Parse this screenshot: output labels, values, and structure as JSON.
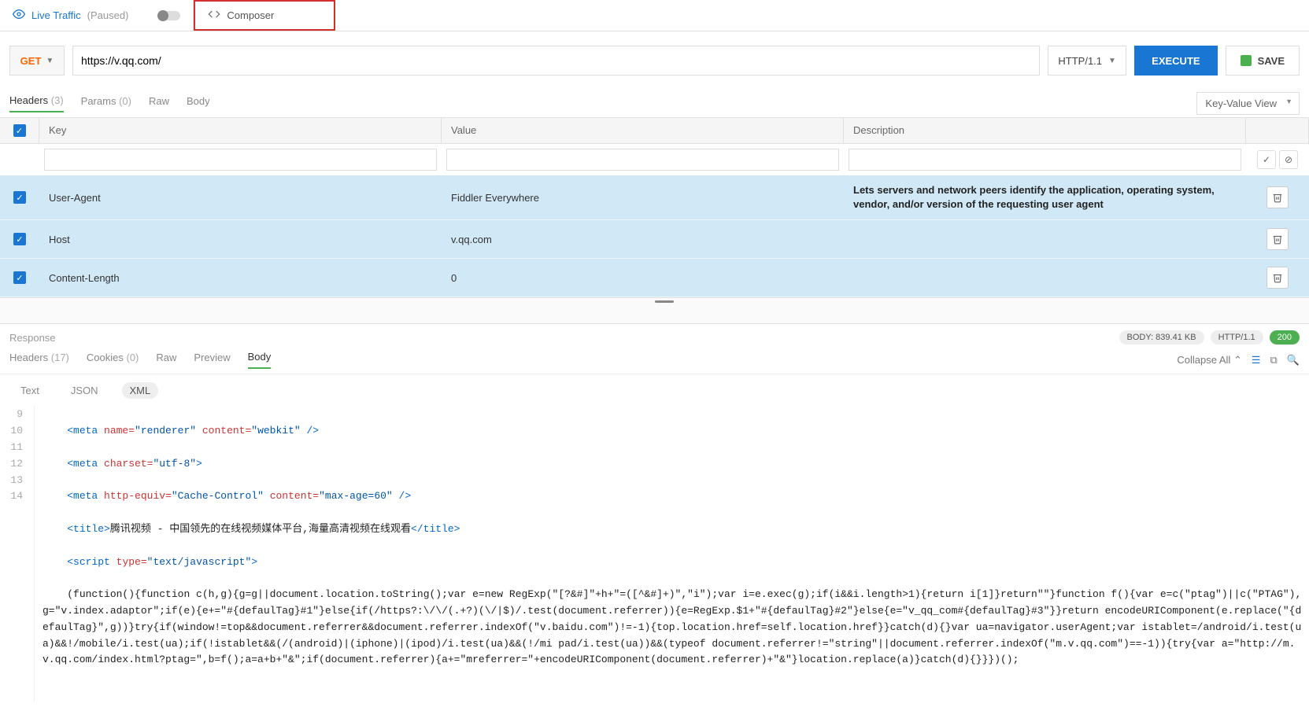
{
  "top": {
    "live_traffic": "Live Traffic",
    "paused": "(Paused)",
    "composer": "Composer"
  },
  "request": {
    "method": "GET",
    "url": "https://v.qq.com/",
    "http_version": "HTTP/1.1",
    "execute": "EXECUTE",
    "save": "SAVE"
  },
  "req_tabs": {
    "headers": "Headers",
    "headers_count": "(3)",
    "params": "Params",
    "params_count": "(0)",
    "raw": "Raw",
    "body": "Body",
    "view_mode": "Key-Value View"
  },
  "header_cols": {
    "key": "Key",
    "value": "Value",
    "description": "Description"
  },
  "headers": [
    {
      "key": "User-Agent",
      "value": "Fiddler Everywhere",
      "desc": "Lets servers and network peers identify the application, operating system, vendor, and/or version of the requesting user agent"
    },
    {
      "key": "Host",
      "value": "v.qq.com",
      "desc": ""
    },
    {
      "key": "Content-Length",
      "value": "0",
      "desc": ""
    }
  ],
  "response": {
    "title": "Response",
    "body_size": "BODY: 839.41 KB",
    "proto": "HTTP/1.1",
    "status": "200",
    "tabs": {
      "headers": "Headers",
      "headers_count": "(17)",
      "cookies": "Cookies",
      "cookies_count": "(0)",
      "raw": "Raw",
      "preview": "Preview",
      "body": "Body"
    },
    "collapse_all": "Collapse All",
    "body_tabs": {
      "text": "Text",
      "json": "JSON",
      "xml": "XML"
    }
  },
  "code": {
    "lines": [
      "9",
      "10",
      "11",
      "12",
      "13",
      "14"
    ],
    "l9_a": "<meta ",
    "l9_b": "name=",
    "l9_c": "\"renderer\"",
    "l9_d": " content=",
    "l9_e": "\"webkit\"",
    "l9_f": " />",
    "l10_a": "<meta ",
    "l10_b": "charset=",
    "l10_c": "\"utf-8\"",
    "l10_d": ">",
    "l11_a": "<meta ",
    "l11_b": "http-equiv=",
    "l11_c": "\"Cache-Control\"",
    "l11_d": " content=",
    "l11_e": "\"max-age=60\"",
    "l11_f": " />",
    "l12_a": "<title>",
    "l12_b": "腾讯视频 - 中国领先的在线视频媒体平台,海量高清视频在线观看",
    "l12_c": "</title>",
    "l13_a": "<script ",
    "l13_b": "type=",
    "l13_c": "\"text/javascript\"",
    "l13_d": ">",
    "l14": "(function(){function c(h,g){g=g||document.location.toString();var e=new RegExp(\"[?&#]\"+h+\"=([^&#]+)\",\"i\");var i=e.exec(g);if(i&&i.length>1){return i[1]}return\"\"}function f(){var e=c(\"ptag\")||c(\"PTAG\"),g=\"v.index.adaptor\";if(e){e+=\"#{defaulTag}#1\"}else{if(/https?:\\/\\/(.+?)(\\/|$)/.test(document.referrer)){e=RegExp.$1+\"#{defaulTag}#2\"}else{e=\"v_qq_com#{defaulTag}#3\"}}return encodeURIComponent(e.replace(\"{defaulTag}\",g))}try{if(window!=top&&document.referrer&&document.referrer.indexOf(\"v.baidu.com\")!=-1){top.location.href=self.location.href}}catch(d){}var ua=navigator.userAgent;var istablet=/android/i.test(ua)&&!/mobile/i.test(ua);if(!istablet&&(/(android)|(iphone)|(ipod)/i.test(ua)&&(!/mi pad/i.test(ua))&&(typeof document.referrer!=\"string\"||document.referrer.indexOf(\"m.v.qq.com\")==-1)){try{var a=\"http://m.v.qq.com/index.html?ptag=\",b=f();a=a+b+\"&\";if(document.referrer){a+=\"mreferrer=\"+encodeURIComponent(document.referrer)+\"&\"}location.replace(a)}catch(d){}}})();"
  }
}
